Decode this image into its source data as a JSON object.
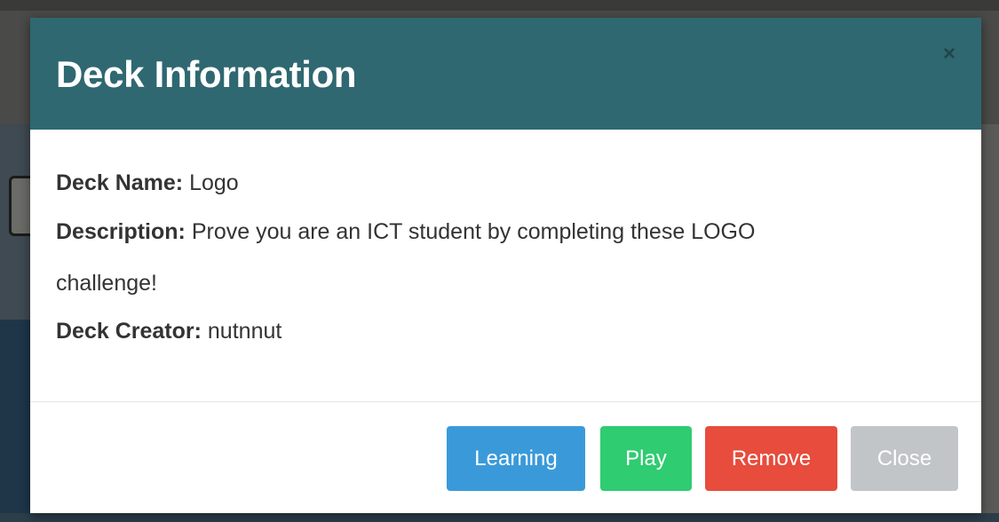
{
  "modal": {
    "title": "Deck Information",
    "close_symbol": "×"
  },
  "deck": {
    "name_label": "Deck Name:",
    "name_value": "Logo",
    "description_label": "Description:",
    "description_value_line1": "Prove you are an ICT student by completing these LOGO",
    "description_value_line2": "challenge!",
    "creator_label": "Deck Creator:",
    "creator_value": "nutnnut"
  },
  "buttons": {
    "learning": "Learning",
    "play": "Play",
    "remove": "Remove",
    "close": "Close"
  },
  "colors": {
    "header": "#2f6871",
    "learning": "#3a9ad9",
    "play": "#2fcc71",
    "remove": "#e74c3c",
    "close": "#c1c5c8"
  }
}
